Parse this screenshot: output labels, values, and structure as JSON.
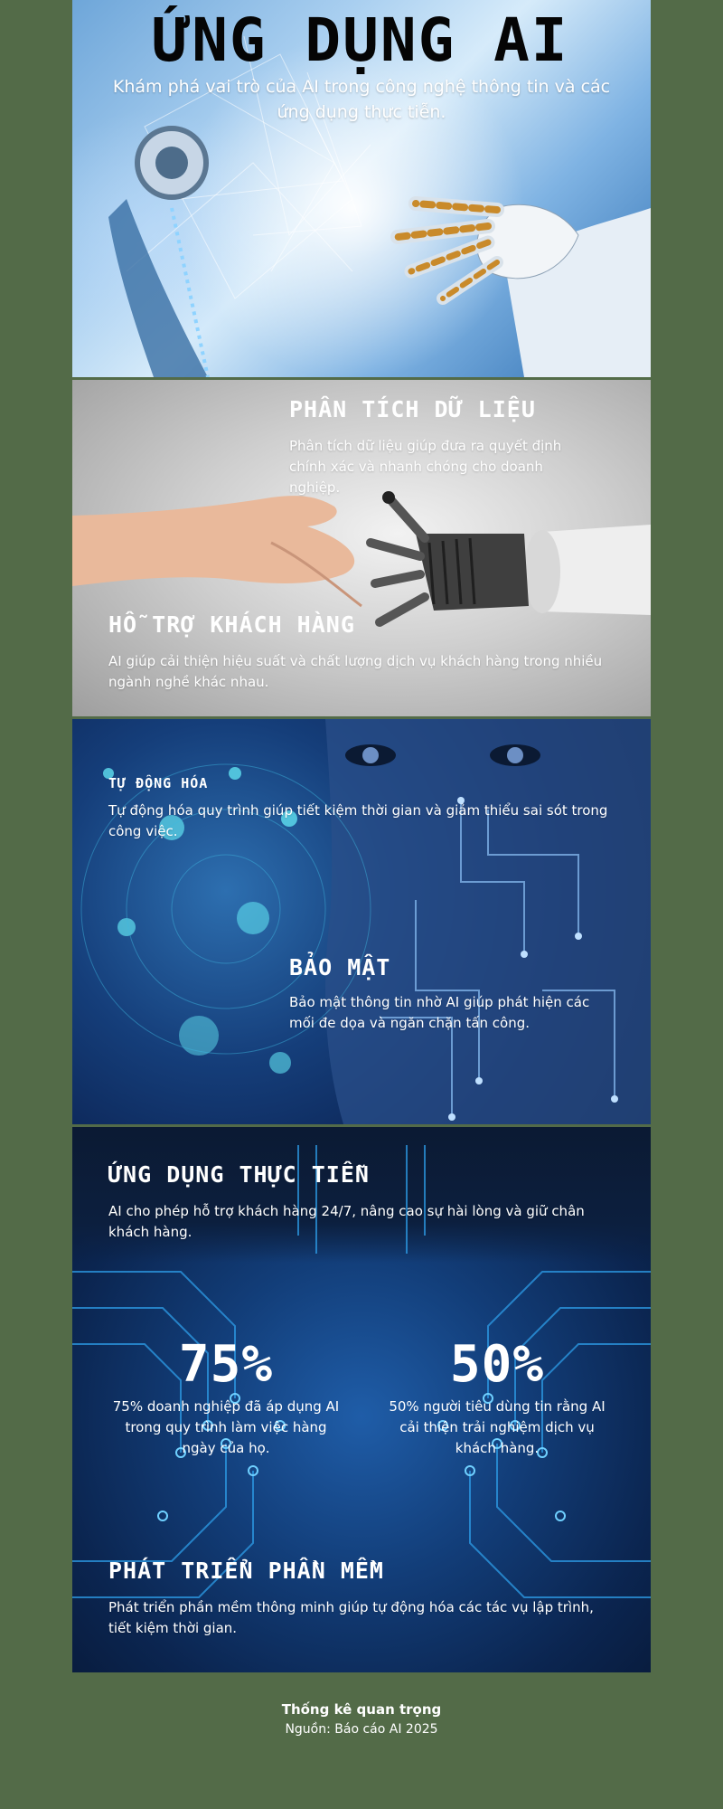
{
  "hero": {
    "title": "ỨNG DỤNG AI",
    "subtitle": "Khám phá vai trò của AI trong công nghệ thông tin và các ứng dụng thực tiễn."
  },
  "sections": {
    "data_analysis": {
      "heading": "PHÂN TÍCH DỮ LIỆU",
      "text": "Phân tích dữ liệu giúp đưa ra quyết định chính xác và nhanh chóng cho doanh nghiệp."
    },
    "customer_support": {
      "heading": "HỖ TRỢ KHÁCH HÀNG",
      "text": "AI giúp cải thiện hiệu suất và chất lượng dịch vụ khách hàng trong nhiều ngành nghề khác nhau."
    },
    "automation": {
      "heading": "TỰ ĐỘNG HÓA",
      "text": "Tự động hóa quy trình giúp tiết kiệm thời gian và giảm thiểu sai sót trong công việc."
    },
    "security": {
      "heading": "BẢO MẬT",
      "text": "Bảo mật thông tin nhờ AI giúp phát hiện các mối đe dọa và ngăn chặn tấn công."
    },
    "practical": {
      "heading": "ỨNG DỤNG THỰC TIỄN",
      "text": "AI cho phép hỗ trợ khách hàng 24/7, nâng cao sự hài lòng và giữ chân khách hàng."
    },
    "software": {
      "heading": "PHÁT TRIỂN PHẦN MỀM",
      "text": "Phát triển phần mềm thông minh giúp tự động hóa các tác vụ lập trình, tiết kiệm thời gian."
    }
  },
  "stats": [
    {
      "value": "75%",
      "text": "75% doanh nghiệp đã áp dụng AI trong quy trình làm việc hàng ngày của họ."
    },
    {
      "value": "50%",
      "text": "50% người tiêu dùng tin rằng AI cải thiện trải nghiệm dịch vụ khách hàng."
    }
  ],
  "footer": {
    "title": "Thống kê quan trọng",
    "source": "Nguồn: Báo cáo AI 2025"
  },
  "colors": {
    "page_background": "#536b48",
    "text": "#ffffff",
    "hero_title": "#050505"
  }
}
